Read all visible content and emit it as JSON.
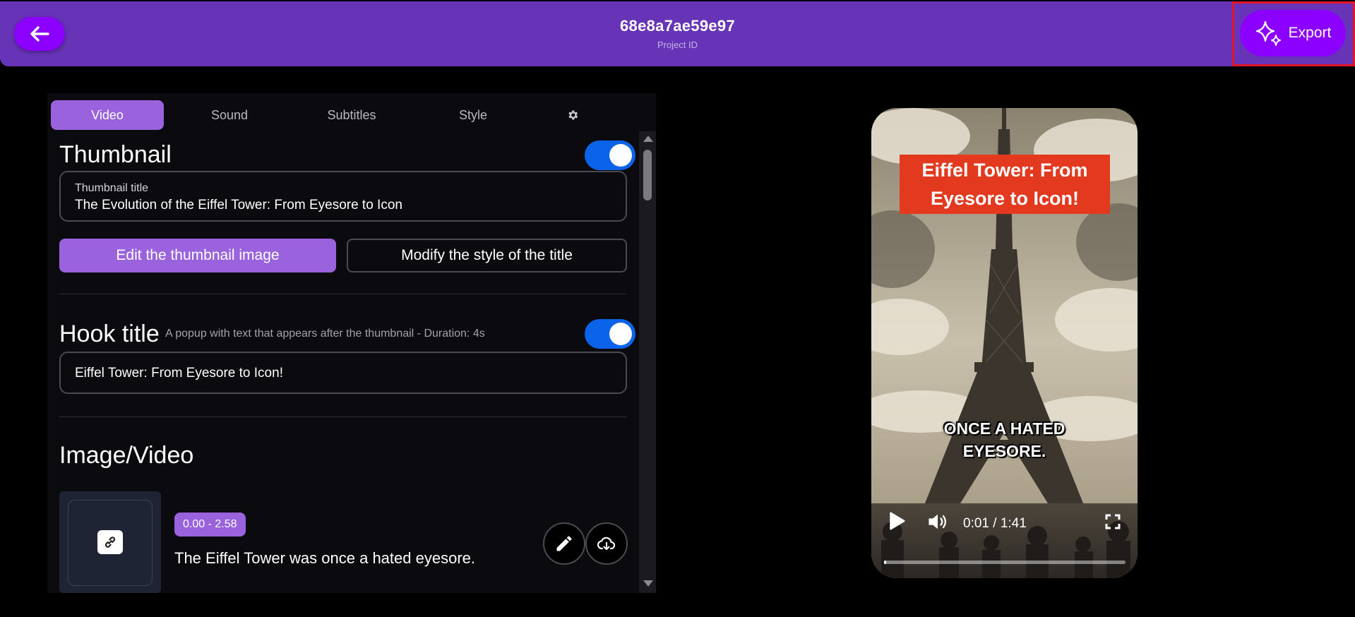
{
  "header": {
    "project_id": "68e8a7ae59e97",
    "project_label": "Project ID",
    "export_label": "Export"
  },
  "tabs": [
    {
      "label": "Video",
      "active": true
    },
    {
      "label": "Sound",
      "active": false
    },
    {
      "label": "Subtitles",
      "active": false
    },
    {
      "label": "Style",
      "active": false
    }
  ],
  "thumbnail": {
    "title": "Thumbnail",
    "enabled": true,
    "field_label": "Thumbnail title",
    "field_value": "The Evolution of the Eiffel Tower: From Eyesore to Icon",
    "edit_image_label": "Edit the thumbnail image",
    "modify_style_label": "Modify the style of the title"
  },
  "hook": {
    "title": "Hook title",
    "hint": "A popup with text that appears after the thumbnail - Duration: 4s",
    "enabled": true,
    "value": "Eiffel Tower: From Eyesore to Icon!"
  },
  "media": {
    "title": "Image/Video",
    "time_range": "0.00 - 2.58",
    "scene_text": "The Eiffel Tower was once a hated eyesore."
  },
  "preview": {
    "hook_text": "Eiffel Tower: From Eyesore to Icon!",
    "caption": "ONCE A HATED EYESORE.",
    "time": "0:01 / 1:41",
    "progress": 0.01
  },
  "colors": {
    "header": "#6733b7",
    "accent": "#8b00ff",
    "tab_active": "#9a62dc",
    "toggle_on": "#0a63e8",
    "hook_card": "#e2391f",
    "export_highlight": "#e0162b"
  },
  "icons": {
    "back": "arrow-left-icon",
    "export": "sparkles-icon",
    "settings": "gear-icon",
    "link": "link-icon",
    "edit": "pencil-icon",
    "download": "cloud-download-icon",
    "play": "play-icon",
    "volume": "volume-icon",
    "fullscreen": "fullscreen-icon"
  }
}
